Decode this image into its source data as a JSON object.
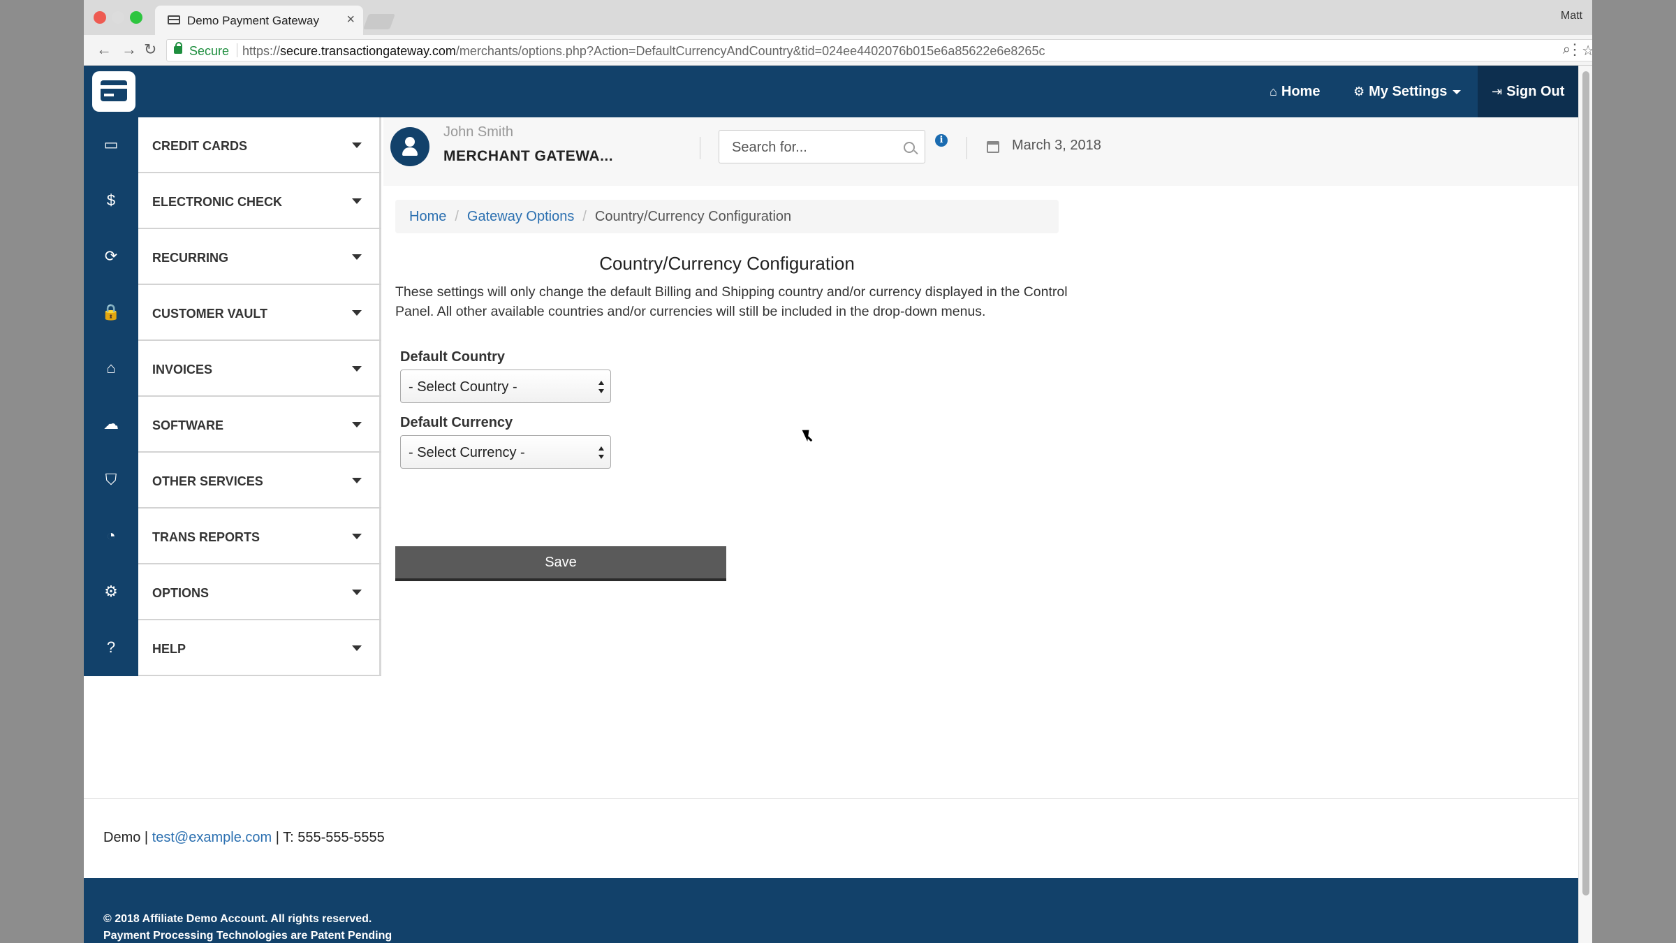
{
  "browser": {
    "tab_title": "Demo Payment Gateway",
    "tab_close": "×",
    "profile_name": "Matt",
    "secure_label": "Secure",
    "url_scheme": "https://",
    "url_host": "secure.transactiongateway.com",
    "url_path": "/merchants/options.php?Action=DefaultCurrencyAndCountry&tid=024ee4402076b015e6a85622e6e8265c",
    "icons": {
      "back": "←",
      "forward": "→",
      "reload": "↻",
      "zoom": "⌕",
      "star": "☆",
      "menu": "⋮"
    }
  },
  "topnav": {
    "home_icon": "⌂",
    "home_label": "Home",
    "settings_icon": "⚙",
    "settings_label": "My Settings",
    "signout_icon": "⇥",
    "signout_label": "Sign Out"
  },
  "sidebar": {
    "items": [
      {
        "label": "CREDIT CARDS",
        "icon": "▭"
      },
      {
        "label": "ELECTRONIC CHECK",
        "icon": "$"
      },
      {
        "label": "RECURRING",
        "icon": "⟳"
      },
      {
        "label": "CUSTOMER VAULT",
        "icon": "🔒"
      },
      {
        "label": "INVOICES",
        "icon": "⌂"
      },
      {
        "label": "SOFTWARE",
        "icon": "☁"
      },
      {
        "label": "OTHER SERVICES",
        "icon": "⛉"
      },
      {
        "label": "TRANS REPORTS",
        "icon": "◔"
      },
      {
        "label": "OPTIONS",
        "icon": "⚙"
      },
      {
        "label": "HELP",
        "icon": "?"
      }
    ]
  },
  "header": {
    "user_name": "John Smith",
    "merchant_name": "MERCHANT GATEWA...",
    "search_placeholder": "Search for...",
    "info_icon": "i",
    "date": "March 3, 2018"
  },
  "breadcrumb": {
    "home": "Home",
    "sep": "/",
    "gateway_options": "Gateway Options",
    "current": "Country/Currency Configuration"
  },
  "main": {
    "title": "Country/Currency Configuration",
    "description": "These settings will only change the default Billing and Shipping country and/or currency displayed in the Control Panel. All other available countries and/or currencies will still be included in the drop-down menus.",
    "country_label": "Default Country",
    "country_value": "- Select Country -",
    "currency_label": "Default Currency",
    "currency_value": "- Select Currency -",
    "save_label": "Save"
  },
  "footer": {
    "company": "Demo",
    "sep1": "|",
    "email": "test@example.com",
    "phone": "| T: 555-555-5555",
    "copyright": "© 2018 Affiliate Demo Account. All rights reserved.",
    "patent": "Payment Processing Technologies are Patent Pending"
  },
  "colors": {
    "brand_navy": "#12416a",
    "link_blue": "#2a6fb0",
    "save_gray": "#5a5a5a"
  }
}
